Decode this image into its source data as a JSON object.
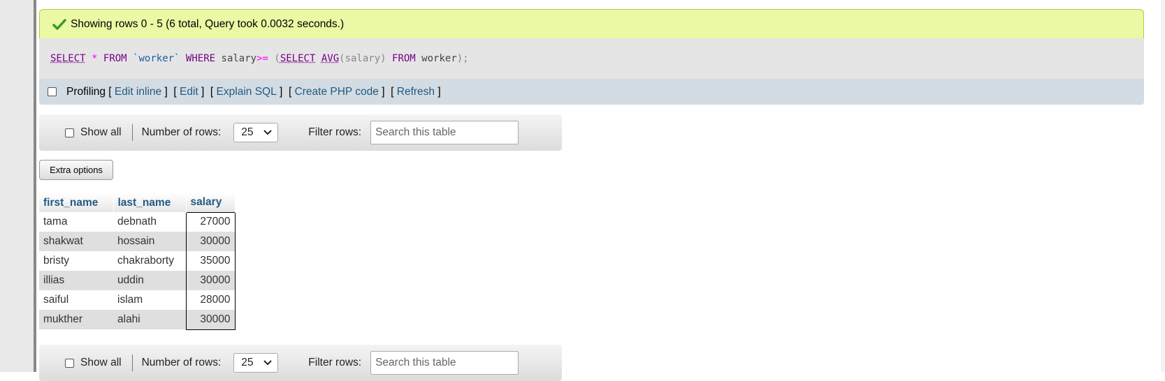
{
  "status": {
    "message": "Showing rows 0 - 5 (6 total, Query took 0.0032 seconds.)",
    "icon": "check-icon",
    "color": "#3a9a2a"
  },
  "sql": {
    "select1": "SELECT",
    "star": "*",
    "from1": "FROM",
    "table": "`worker`",
    "where": "WHERE",
    "column": "salary",
    "op": ">=",
    "paren_open": "(",
    "select2": "SELECT",
    "avg": "AVG",
    "avg_arg": "(salary)",
    "from2": "FROM",
    "table2": "worker",
    "end": ");"
  },
  "profiling": {
    "label": "Profiling",
    "links": [
      "Edit inline",
      "Edit",
      "Explain SQL",
      "Create PHP code",
      "Refresh"
    ]
  },
  "nav": {
    "show_all": "Show all",
    "num_rows_label": "Number of rows:",
    "num_rows_value": "25",
    "filter_label": "Filter rows:",
    "filter_placeholder": "Search this table"
  },
  "extra_options": "Extra options",
  "table": {
    "columns": [
      "first_name",
      "last_name",
      "salary"
    ],
    "rows": [
      [
        "tama",
        "debnath",
        "27000"
      ],
      [
        "shakwat",
        "hossain",
        "30000"
      ],
      [
        "bristy",
        "chakraborty",
        "35000"
      ],
      [
        "illias",
        "uddin",
        "30000"
      ],
      [
        "saiful",
        "islam",
        "28000"
      ],
      [
        "mukther",
        "alahi",
        "30000"
      ]
    ]
  }
}
